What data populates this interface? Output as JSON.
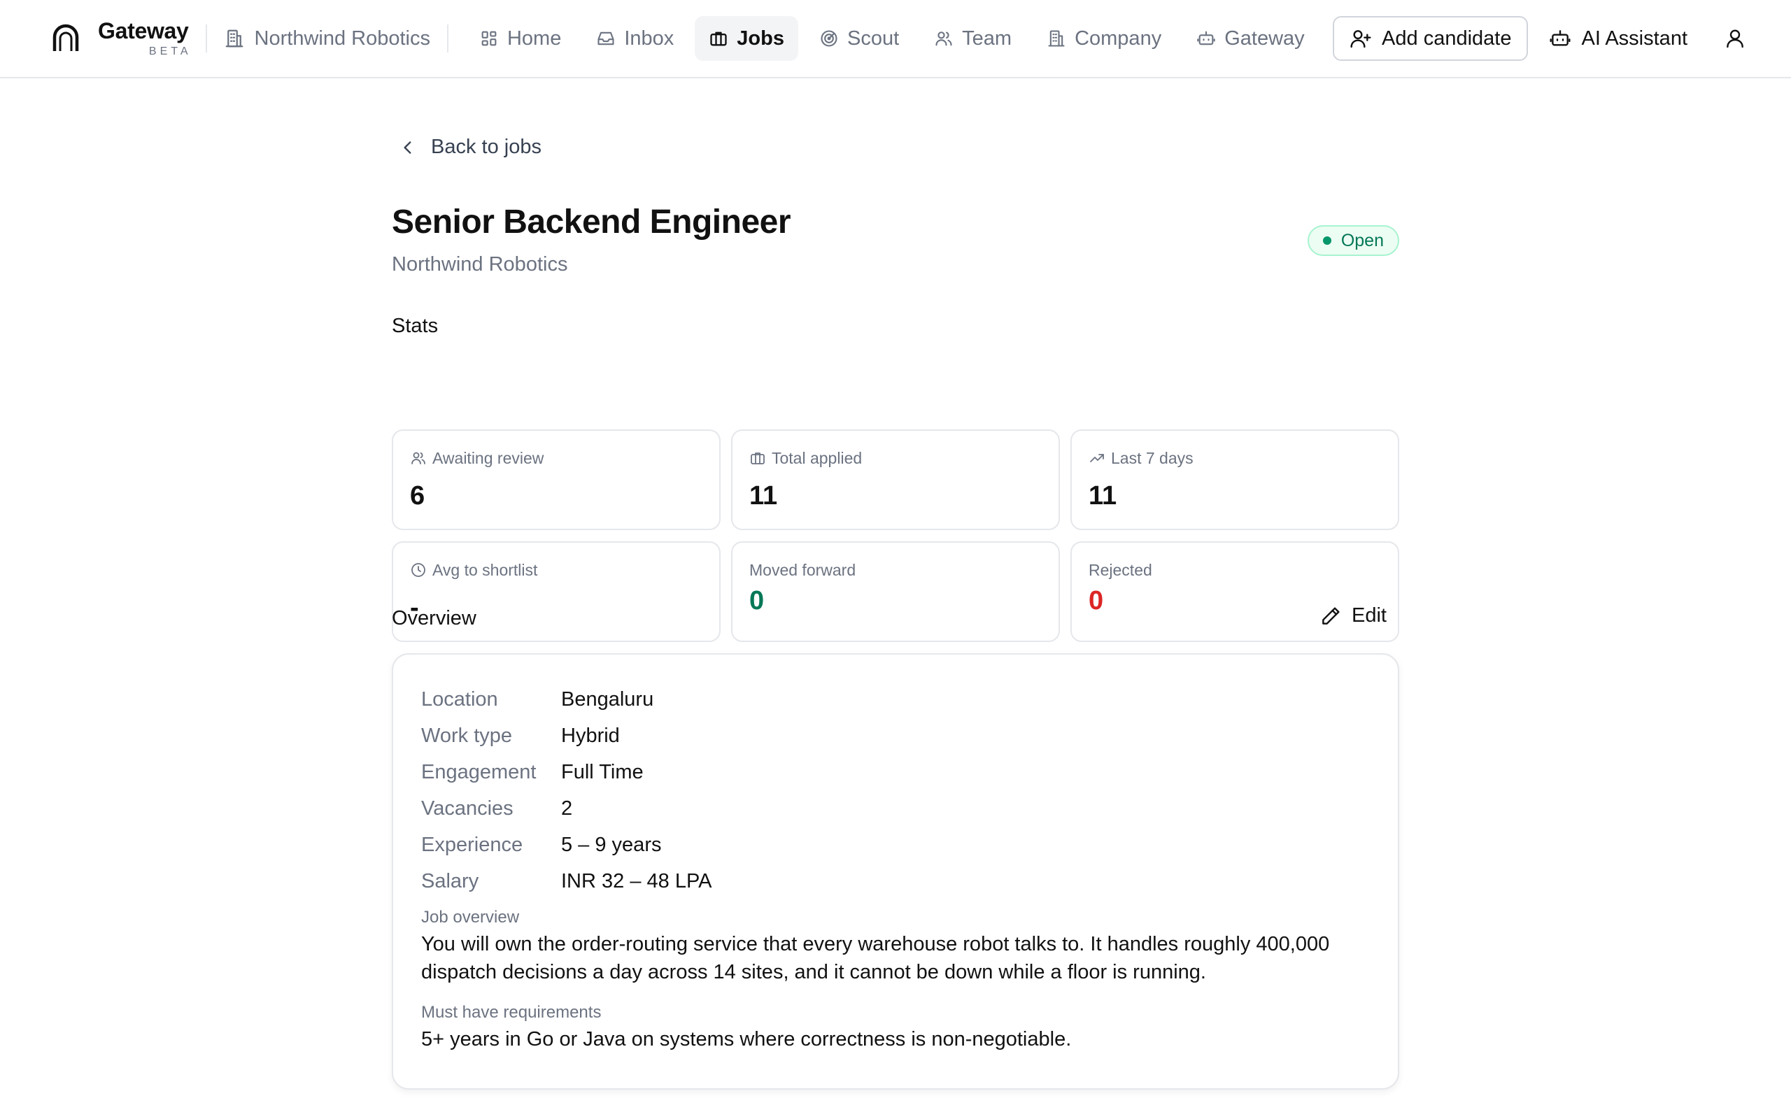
{
  "brand": {
    "name": "Gateway",
    "tag": "BETA"
  },
  "org": {
    "name": "Northwind Robotics"
  },
  "nav": {
    "home": "Home",
    "inbox": "Inbox",
    "jobs": "Jobs",
    "scout": "Scout",
    "team": "Team",
    "company": "Company",
    "gateway": "Gateway"
  },
  "actions": {
    "add_candidate": "Add candidate",
    "ai_assistant": "AI Assistant"
  },
  "back": {
    "label": "Back to jobs"
  },
  "job": {
    "title": "Senior Backend Engineer",
    "company": "Northwind Robotics",
    "status": "Open"
  },
  "stats": {
    "heading": "Stats",
    "awaiting_review": {
      "label": "Awaiting review",
      "value": "6"
    },
    "total_applied": {
      "label": "Total applied",
      "value": "11"
    },
    "last_7_days": {
      "label": "Last 7 days",
      "value": "11"
    },
    "avg_to_shortlist": {
      "label": "Avg to shortlist",
      "value": "-"
    },
    "moved_forward": {
      "label": "Moved forward",
      "value": "0"
    },
    "rejected": {
      "label": "Rejected",
      "value": "0"
    }
  },
  "overview": {
    "heading": "Overview",
    "edit_label": "Edit",
    "details": [
      {
        "key": "Location",
        "value": "Bengaluru"
      },
      {
        "key": "Work type",
        "value": "Hybrid"
      },
      {
        "key": "Engagement",
        "value": "Full Time"
      },
      {
        "key": "Vacancies",
        "value": "2"
      },
      {
        "key": "Experience",
        "value": "5 – 9 years"
      },
      {
        "key": "Salary",
        "value": "INR 32 – 48 LPA"
      }
    ],
    "job_overview_label": "Job overview",
    "job_overview_text": "You will own the order-routing service that every warehouse robot talks to. It handles roughly 400,000 dispatch decisions a day across 14 sites, and it cannot be down while a floor is running.",
    "must_have_label": "Must have requirements",
    "must_have_text": "5+ years in Go or Java on systems where correctness is non-negotiable."
  },
  "colors": {
    "accent_green": "#047857",
    "reject_red": "#dc2626",
    "border": "#e5e7eb",
    "muted": "#6b7280"
  }
}
